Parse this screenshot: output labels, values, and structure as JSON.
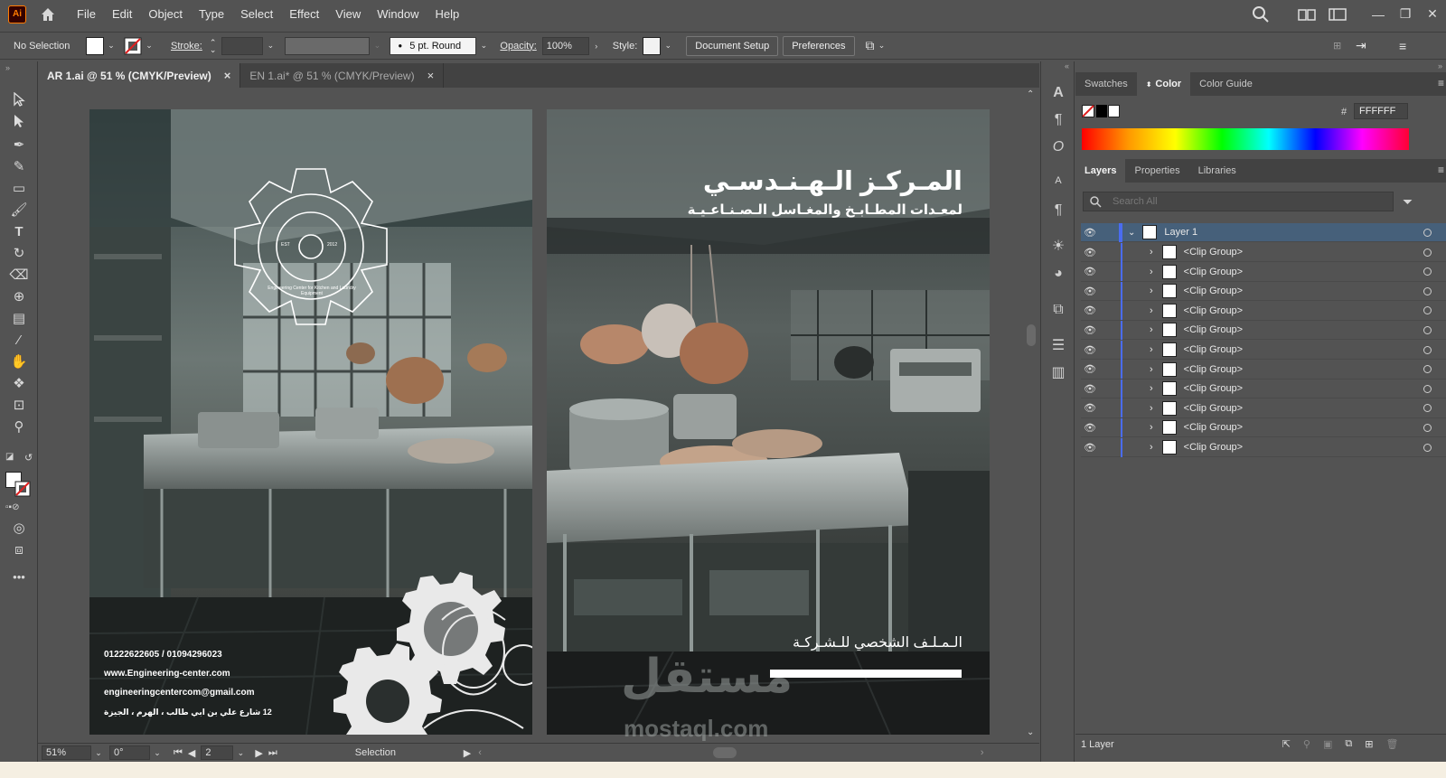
{
  "app": {
    "logo": "Ai",
    "menu": [
      "File",
      "Edit",
      "Object",
      "Type",
      "Select",
      "Effect",
      "View",
      "Window",
      "Help"
    ]
  },
  "control_bar": {
    "selection": "No Selection",
    "stroke_label": "Stroke:",
    "brush": "5 pt. Round",
    "opacity_label": "Opacity:",
    "opacity_value": "100%",
    "style_label": "Style:",
    "document_setup": "Document Setup",
    "preferences": "Preferences"
  },
  "tabs": [
    {
      "label": "AR 1.ai @ 51 % (CMYK/Preview)",
      "close": "×"
    },
    {
      "label": "EN 1.ai* @ 51 % (CMYK/Preview)",
      "close": "×"
    }
  ],
  "artboard_left": {
    "contacts": [
      "01222622605 / 01094296023",
      "www.Engineering-center.com",
      "engineeringcentercom@gmail.com",
      "12 شارع علي بن ابي طالب ، الهرم ، الجيزة"
    ],
    "logo_ring_text": "Engineering Center for Kitchen and Laundry Equipment",
    "logo_est": "EST",
    "logo_year": "2012"
  },
  "artboard_right": {
    "title": "المـركـز الـهـنـدسـي",
    "subtitle": "لمعـدات المطـابـخ والمغـاسل الـصـنـاعـيـة",
    "profile": "الـمـلـف الشخصي للـشـركـة"
  },
  "watermark": {
    "arabic": "مستقل",
    "latin": "mostaql.com"
  },
  "status_bar": {
    "zoom": "51%",
    "rotation": "0°",
    "page": "2",
    "tool": "Selection"
  },
  "color_panel": {
    "tabs": [
      "Swatches",
      "Color",
      "Color Guide"
    ],
    "active": "Color",
    "hex_prefix": "#",
    "hex": "FFFFFF"
  },
  "layers_panel": {
    "tabs": [
      "Layers",
      "Properties",
      "Libraries"
    ],
    "active": "Layers",
    "search_placeholder": "Search All",
    "layer_name": "Layer 1",
    "items": [
      "<Clip Group>",
      "<Clip Group>",
      "<Clip Group>",
      "<Clip Group>",
      "<Clip Group>",
      "<Clip Group>",
      "<Clip Group>",
      "<Clip Group>",
      "<Clip Group>",
      "<Clip Group>",
      "<Clip Group>"
    ],
    "footer": "1 Layer"
  },
  "colors": {
    "accent": "#ff7c00",
    "selection": "#46607a",
    "layer_color": "#4a6cf0"
  }
}
